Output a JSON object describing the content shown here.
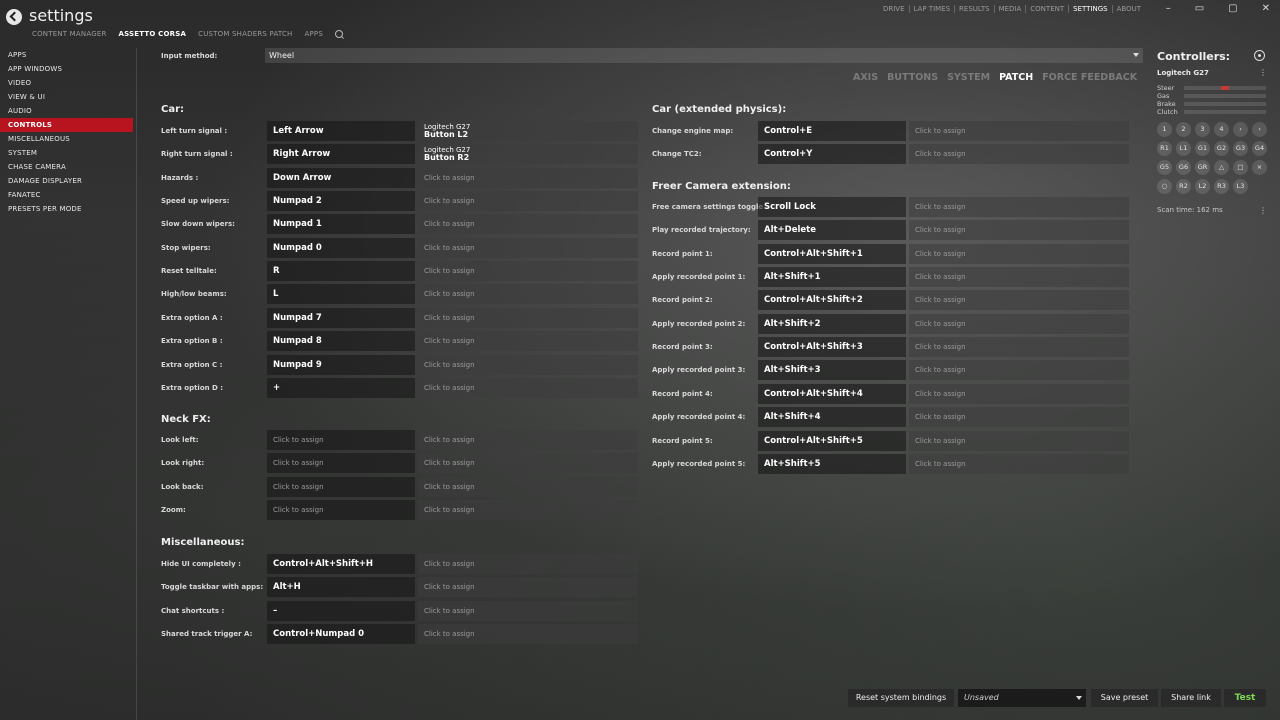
{
  "header": {
    "title": "settings",
    "subnav": [
      "CONTENT MANAGER",
      "ASSETTO CORSA",
      "CUSTOM SHADERS PATCH",
      "APPS"
    ],
    "subnav_active": "ASSETTO CORSA",
    "topnav": [
      "DRIVE",
      "LAP TIMES",
      "RESULTS",
      "MEDIA",
      "CONTENT",
      "SETTINGS",
      "ABOUT"
    ],
    "topnav_active": "SETTINGS",
    "window_controls": [
      "–",
      "▭",
      "▢",
      "✕"
    ]
  },
  "sidebar": {
    "items": [
      "APPS",
      "APP WINDOWS",
      "VIDEO",
      "VIEW & UI",
      "AUDIO",
      "CONTROLS",
      "MISCELLANEOUS",
      "SYSTEM",
      "CHASE CAMERA",
      "DAMAGE DISPLAYER",
      "FANATEC",
      "PRESETS PER MODE"
    ],
    "active": "CONTROLS"
  },
  "input_method": {
    "label": "Input method:",
    "value": "Wheel"
  },
  "tabs": [
    "AXIS",
    "BUTTONS",
    "SYSTEM",
    "PATCH",
    "FORCE FEEDBACK"
  ],
  "tabs_active": "PATCH",
  "placeholder": "Click to assign",
  "left_sections": [
    {
      "title": "Car:",
      "rows": [
        {
          "label": "Left turn signal :",
          "primary": "Left Arrow",
          "secondary": [
            "Logitech G27",
            "Button L2"
          ]
        },
        {
          "label": "Right turn signal :",
          "primary": "Right Arrow",
          "secondary": [
            "Logitech G27",
            "Button R2"
          ]
        },
        {
          "label": "Hazards :",
          "primary": "Down Arrow",
          "secondary": null
        },
        {
          "label": "Speed up wipers:",
          "primary": "Numpad 2",
          "secondary": null
        },
        {
          "label": "Slow down wipers:",
          "primary": "Numpad 1",
          "secondary": null
        },
        {
          "label": "Stop wipers:",
          "primary": "Numpad 0",
          "secondary": null
        },
        {
          "label": "Reset telltale:",
          "primary": "R",
          "secondary": null
        },
        {
          "label": "High/low beams:",
          "primary": "L",
          "secondary": null
        },
        {
          "label": "Extra option A :",
          "primary": "Numpad 7",
          "secondary": null
        },
        {
          "label": "Extra option B :",
          "primary": "Numpad 8",
          "secondary": null
        },
        {
          "label": "Extra option C :",
          "primary": "Numpad 9",
          "secondary": null
        },
        {
          "label": "Extra option D :",
          "primary": "+",
          "secondary": null
        }
      ]
    },
    {
      "title": "Neck FX:",
      "rows": [
        {
          "label": "Look left:",
          "primary": null,
          "secondary": null
        },
        {
          "label": "Look right:",
          "primary": null,
          "secondary": null
        },
        {
          "label": "Look back:",
          "primary": null,
          "secondary": null
        },
        {
          "label": "Zoom:",
          "primary": null,
          "secondary": null
        }
      ]
    },
    {
      "title": "Miscellaneous:",
      "rows": [
        {
          "label": "Hide UI completely :",
          "primary": "Control+Alt+Shift+H",
          "secondary": null
        },
        {
          "label": "Toggle taskbar with apps:",
          "primary": "Alt+H",
          "secondary": null
        },
        {
          "label": "Chat shortcuts :",
          "primary": "–",
          "secondary": null
        },
        {
          "label": "Shared track trigger A:",
          "primary": "Control+Numpad 0",
          "secondary": null
        }
      ]
    }
  ],
  "right_sections": [
    {
      "title": "Car (extended physics):",
      "rows": [
        {
          "label": "Change engine map:",
          "primary": "Control+E",
          "secondary": null
        },
        {
          "label": "Change TC2:",
          "primary": "Control+Y",
          "secondary": null
        }
      ]
    },
    {
      "title": "Freer Camera extension:",
      "rows": [
        {
          "label": "Free camera settings toggle :",
          "primary": "Scroll Lock",
          "secondary": null
        },
        {
          "label": "Play recorded trajectory:",
          "primary": "Alt+Delete",
          "secondary": null
        },
        {
          "label": "Record point 1:",
          "primary": "Control+Alt+Shift+1",
          "secondary": null
        },
        {
          "label": "Apply recorded point 1:",
          "primary": "Alt+Shift+1",
          "secondary": null
        },
        {
          "label": "Record point 2:",
          "primary": "Control+Alt+Shift+2",
          "secondary": null
        },
        {
          "label": "Apply recorded point 2:",
          "primary": "Alt+Shift+2",
          "secondary": null
        },
        {
          "label": "Record point 3:",
          "primary": "Control+Alt+Shift+3",
          "secondary": null
        },
        {
          "label": "Apply recorded point 3:",
          "primary": "Alt+Shift+3",
          "secondary": null
        },
        {
          "label": "Record point 4:",
          "primary": "Control+Alt+Shift+4",
          "secondary": null
        },
        {
          "label": "Apply recorded point 4:",
          "primary": "Alt+Shift+4",
          "secondary": null
        },
        {
          "label": "Record point 5:",
          "primary": "Control+Alt+Shift+5",
          "secondary": null
        },
        {
          "label": "Apply recorded point 5:",
          "primary": "Alt+Shift+5",
          "secondary": null
        }
      ]
    }
  ],
  "controllers": {
    "title": "Controllers:",
    "device": "Logitech G27",
    "axes": [
      {
        "name": "Steer",
        "level": 0.5
      },
      {
        "name": "Gas",
        "level": 0.0
      },
      {
        "name": "Brake",
        "level": 0.0
      },
      {
        "name": "Clutch",
        "level": 0.0
      }
    ],
    "buttons": [
      "1",
      "2",
      "3",
      "4",
      "›",
      "‹",
      "R1",
      "L1",
      "G1",
      "G2",
      "G3",
      "G4",
      "G5",
      "G6",
      "GR",
      "△",
      "□",
      "×",
      "○",
      "R2",
      "L2",
      "R3",
      "L3"
    ],
    "scan_time": "Scan time: 162 ms"
  },
  "bottom": {
    "reset_label": "Reset system bindings",
    "preset_value": "Unsaved",
    "save_label": "Save preset",
    "share_label": "Share link",
    "test_label": "Test",
    "test_color": "#7ed957"
  }
}
